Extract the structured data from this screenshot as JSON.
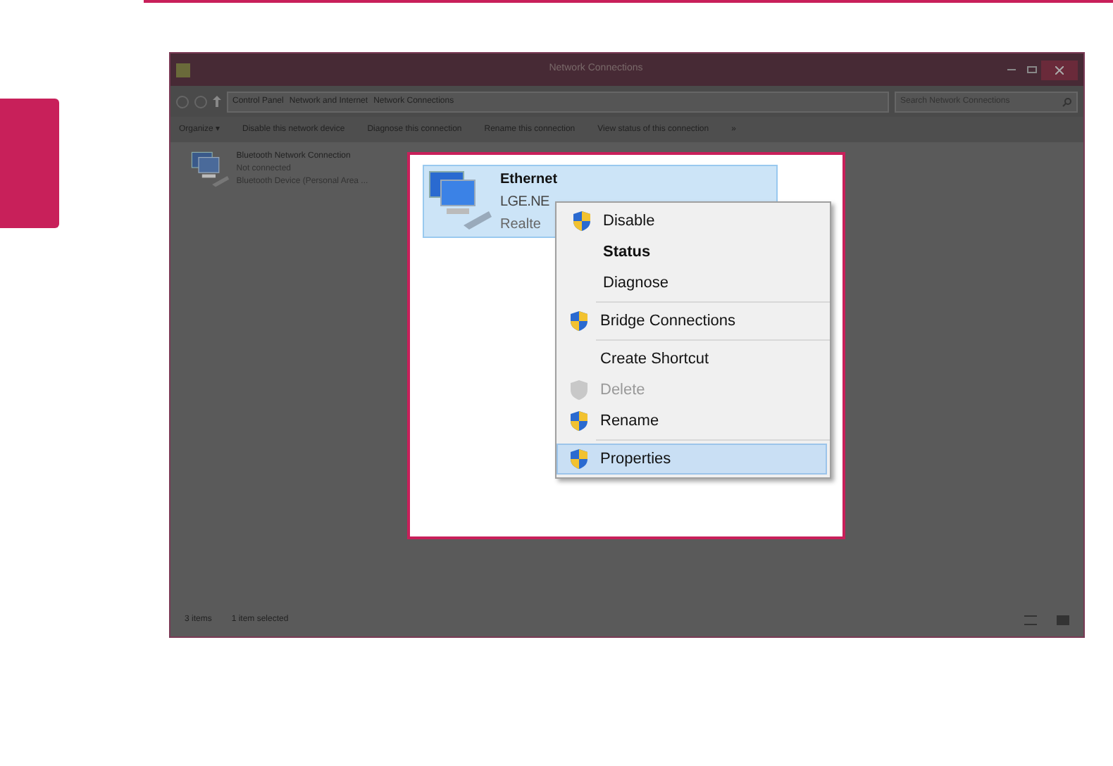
{
  "window": {
    "title": "Network Connections"
  },
  "address": {
    "breadcrumb": [
      "Control Panel",
      "Network and Internet",
      "Network Connections"
    ],
    "search_placeholder": "Search Network Connections"
  },
  "toolbar": [
    "Organize ▾",
    "Disable this network device",
    "Diagnose this connection",
    "Rename this connection",
    "View status of this connection",
    "»"
  ],
  "connections": [
    {
      "name": "Bluetooth Network Connection",
      "status": "Not connected",
      "device": "Bluetooth Device (Personal Area ...",
      "selected": false
    },
    {
      "name": "Ethernet",
      "status": "LGE.NE",
      "device": "Realte",
      "selected": true
    }
  ],
  "context_menu": [
    [
      {
        "label": "Disable",
        "shield": true,
        "bold": false,
        "disabled": false,
        "selected": false
      },
      {
        "label": "Status",
        "shield": false,
        "bold": true,
        "disabled": false,
        "selected": false
      },
      {
        "label": "Diagnose",
        "shield": false,
        "bold": false,
        "disabled": false,
        "selected": false
      }
    ],
    [
      {
        "label": "Bridge Connections",
        "shield": true,
        "bold": false,
        "disabled": false,
        "selected": false
      }
    ],
    [
      {
        "label": "Create Shortcut",
        "shield": false,
        "bold": false,
        "disabled": false,
        "selected": false
      },
      {
        "label": "Delete",
        "shield": true,
        "bold": false,
        "disabled": true,
        "selected": false
      },
      {
        "label": "Rename",
        "shield": true,
        "bold": false,
        "disabled": false,
        "selected": false
      }
    ],
    [
      {
        "label": "Properties",
        "shield": true,
        "bold": false,
        "disabled": false,
        "selected": true
      }
    ]
  ],
  "status_bar": [
    "3 items",
    "1 item selected"
  ]
}
